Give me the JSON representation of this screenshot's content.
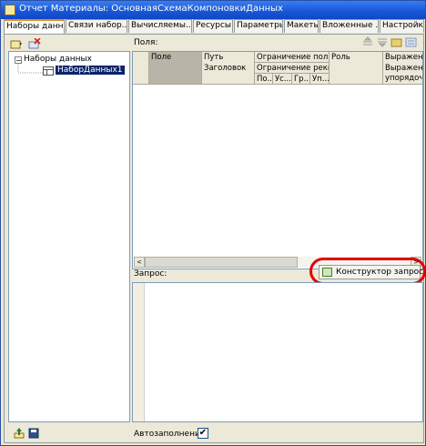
{
  "window": {
    "title": "Отчет Материалы: ОсновнаяСхемаКомпоновкиДанных"
  },
  "tabs": [
    {
      "label": "Наборы данн..."
    },
    {
      "label": "Связи набор..."
    },
    {
      "label": "Вычисляемы..."
    },
    {
      "label": "Ресурсы"
    },
    {
      "label": "Параметры"
    },
    {
      "label": "Макеты"
    },
    {
      "label": "Вложенные ..."
    },
    {
      "label": "Настройки"
    }
  ],
  "tree": {
    "root_label": "Наборы данных",
    "child_label": "НаборДанных1",
    "expander": "−"
  },
  "fields": {
    "label": "Поля:",
    "columns": {
      "field": "Поле",
      "path": "Путь",
      "title": "Заголовок",
      "restrict": "Ограничение поля",
      "restrict_req": "Ограничение рекв...",
      "sub1": "По...",
      "sub2": "Ус...",
      "sub3": "Гр...",
      "sub4": "Уп...",
      "role": "Роль",
      "expr": "Выражение",
      "expr_order": "Выражение упорядоче..."
    }
  },
  "query": {
    "label": "Запрос:",
    "constructor_button": "Конструктор запроса..."
  },
  "autofill": {
    "label": "Автозаполнение",
    "checked": true,
    "check_glyph": "✔"
  },
  "scroll": {
    "left": "<",
    "right": ">"
  },
  "colors": {
    "title_bar": "#1857d6",
    "accent_tab": "#e68b2c",
    "highlight": "#e10000"
  }
}
